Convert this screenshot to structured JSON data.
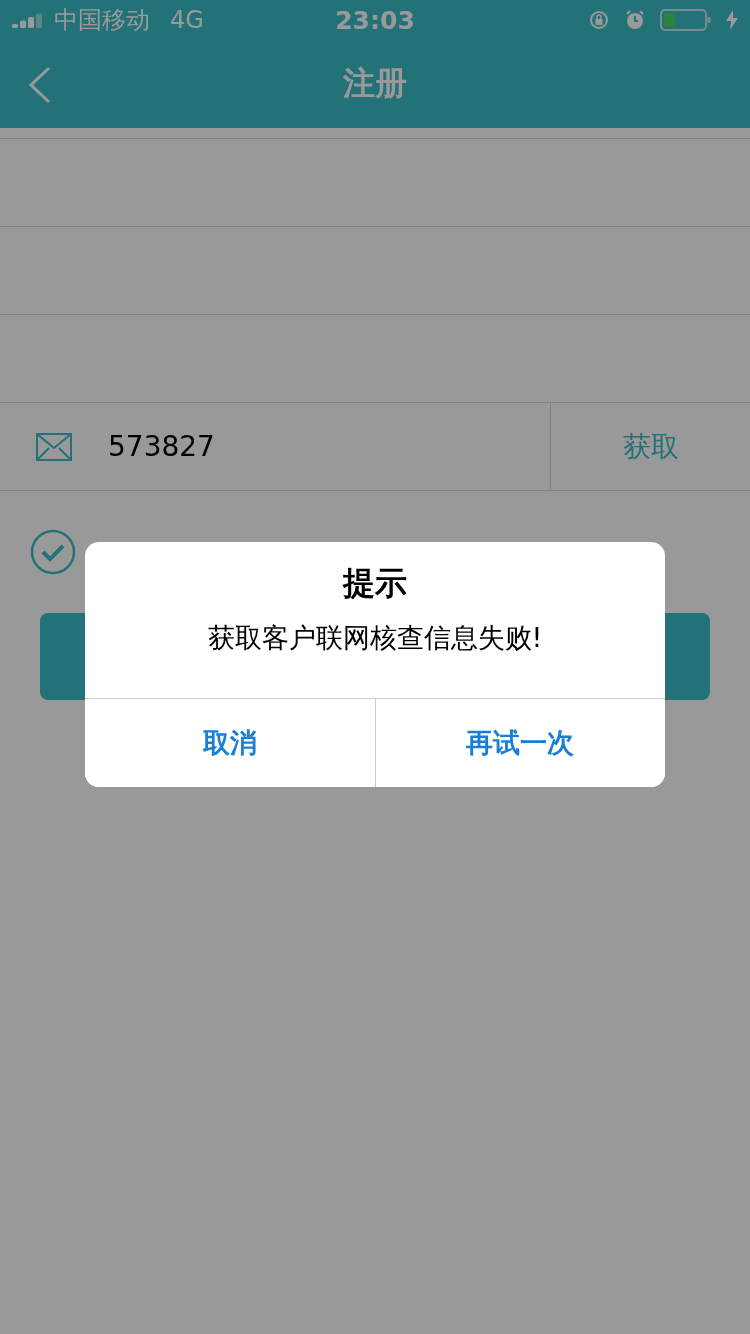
{
  "status_bar": {
    "carrier": "中国移动",
    "network": "4G",
    "time": "23:03"
  },
  "nav": {
    "title": "注册"
  },
  "form": {
    "code_field": {
      "value": "573827",
      "action": "获取"
    },
    "agreement": {
      "checked": true
    }
  },
  "dialog": {
    "title": "提示",
    "message": "获取客户联网核查信息失败!",
    "buttons": [
      {
        "label": "取消"
      },
      {
        "label": "再试一次"
      }
    ]
  }
}
